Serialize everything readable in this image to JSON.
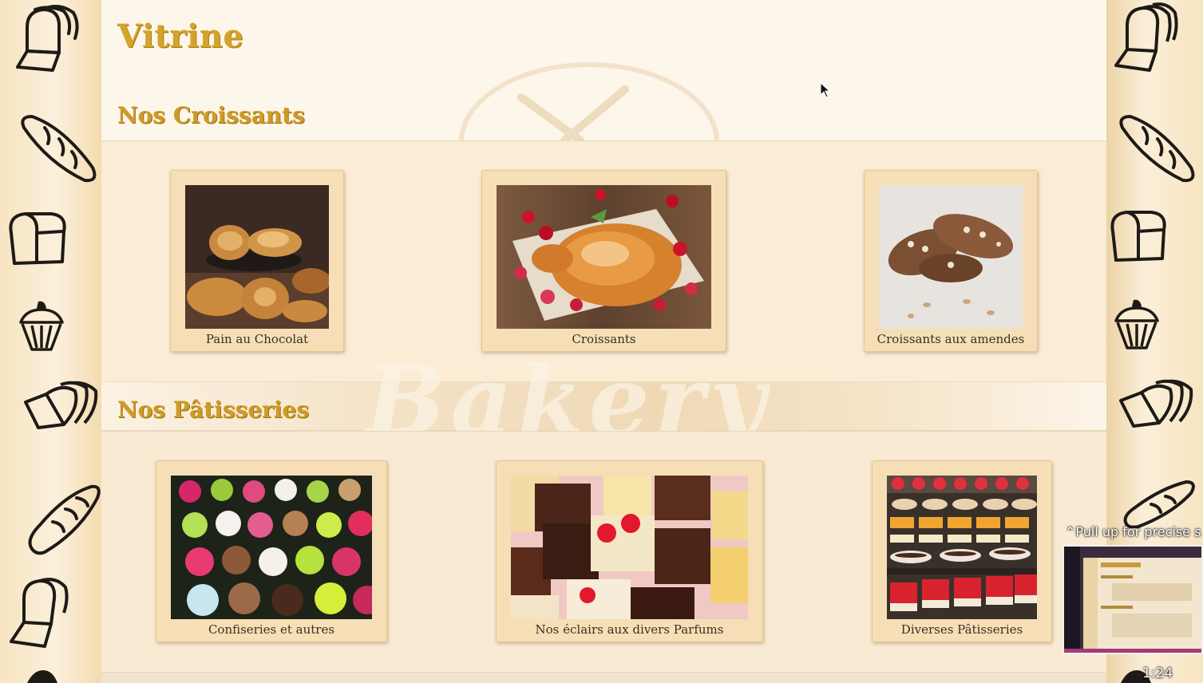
{
  "page": {
    "title": "Vitrine"
  },
  "sections": [
    {
      "heading": "Nos Croissants",
      "items": [
        {
          "label": "Pain au Chocolat"
        },
        {
          "label": "Croissants"
        },
        {
          "label": "Croissants aux amendes"
        }
      ]
    },
    {
      "heading": "Nos Pâtisseries",
      "items": [
        {
          "label": "Confiseries et autres"
        },
        {
          "label": "Nos éclairs aux divers Parfums"
        },
        {
          "label": "Diverses Pâtisseries"
        }
      ]
    }
  ],
  "watermark": "Bakery",
  "overlay": {
    "pull_up": "Pull up for precise s",
    "time": "1:24"
  },
  "colors": {
    "heading": "#d4a32b",
    "card_bg": "#f6dfb6",
    "page_bg": "#fdf6ea"
  },
  "icons": {
    "side_left": [
      "bread-loaf-icon",
      "baguette-icon",
      "toast-icon",
      "cupcake-icon",
      "sliced-bread-icon",
      "baguette-icon",
      "sliced-bread-icon",
      "cupcake-icon"
    ],
    "side_right": [
      "sliced-bread-icon",
      "baguette-icon",
      "toast-icon",
      "cupcake-icon",
      "sliced-bread-icon",
      "baguette-icon",
      "cupcake-icon"
    ]
  }
}
